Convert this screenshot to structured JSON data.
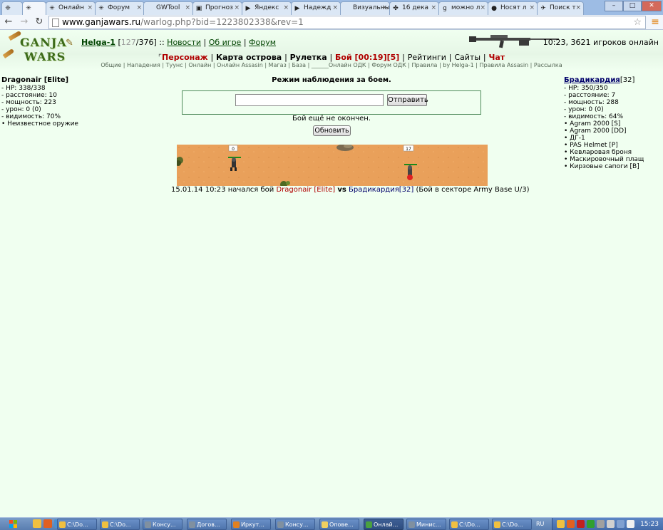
{
  "browser": {
    "tabs": [
      {
        "label": "",
        "icon": "❈"
      },
      {
        "label": "",
        "icon": "✳"
      },
      {
        "label": "Онлайн",
        "icon": "✳"
      },
      {
        "label": "Форум",
        "icon": "✳"
      },
      {
        "label": "GWTool",
        "icon": ""
      },
      {
        "label": "Прогноз",
        "icon": "▣"
      },
      {
        "label": "Яндекс",
        "icon": "▶"
      },
      {
        "label": "Надежд",
        "icon": "▶"
      },
      {
        "label": "Визуальны",
        "icon": ""
      },
      {
        "label": "16 дека",
        "icon": "✤"
      },
      {
        "label": "можно л",
        "icon": "g"
      },
      {
        "label": "Носят л",
        "icon": "●"
      },
      {
        "label": "Поиск т",
        "icon": "✈"
      }
    ],
    "window_buttons": {
      "minimize": "–",
      "maximize": "□",
      "close": "✕"
    },
    "back": "←",
    "forward": "→",
    "reload": "↻",
    "url_host": "www.ganjawars.ru",
    "url_path": "/warlog.php?bid=1223802338&rev=1",
    "bookmark": "☆",
    "menu": "≡"
  },
  "header": {
    "logo_top": "GANJA",
    "logo_bottom": "WARS",
    "username": "Helga-1",
    "hp_current": "127",
    "hp_max": "/376]",
    "hp_open": "[",
    "dots": "::",
    "links": [
      "Новости",
      "Об игре",
      "Форум"
    ],
    "online": "10:23, 3621 игроков онлайн"
  },
  "mainnav": {
    "items": [
      "Персонаж",
      "Карта острова",
      "Рулетка",
      "Бой [00:19][5]",
      "Рейтинги",
      "Сайты",
      "Чат"
    ]
  },
  "subnav": "Общие | Нападения | Туунс | Онлайн | Онлайн Assasin | Магаз | База | ______Онлайн ОДК | Форум ОДК | Правила | by Helga-1 | Правила Assasin | Рассылка",
  "left_player": {
    "name": "Dragonair [Elite]",
    "stats": [
      "- HP: 338/338",
      "- расстояние: 10",
      "- мощность: 223",
      "- урон: 0 (0)",
      "- видимость: 70%"
    ],
    "items": [
      "Неизвестное оружие"
    ]
  },
  "right_player": {
    "name": "Брадикардия",
    "level": "[32]",
    "stats": [
      "- HP: 350/350",
      "- расстояние: 7",
      "- мощность: 288",
      "- урон: 0 (0)",
      "- видимость: 64%"
    ],
    "items": [
      "Agram 2000 [S]",
      "Agram 2000 [DD]",
      "ДГ-1",
      "PAS Helmet [P]",
      "Кевларовая броня",
      "Маскировочный плащ",
      "Кирзовые сапоги [B]"
    ]
  },
  "battle": {
    "title": "Режим наблюдения за боем.",
    "send_label": "Отправить",
    "status": "Бой ещё не окончен.",
    "refresh_label": "Обновить",
    "left_marker": "0",
    "right_marker": "17",
    "log_prefix": "15.01.14 10:23 начался бой",
    "log_red": "Dragonair [Elite]",
    "log_vs": "vs",
    "log_blue": "Брадикардия",
    "log_level": "[32]",
    "log_suffix": "(Бой в секторе Army Base U/3)"
  },
  "taskbar": {
    "windows": [
      {
        "label": "C:\\Do...",
        "color": "#f0c040"
      },
      {
        "label": "C:\\Do...",
        "color": "#f0c040"
      },
      {
        "label": "Консу...",
        "color": "#8090a0"
      },
      {
        "label": "Догов...",
        "color": "#8090a0"
      },
      {
        "label": "Иркут...",
        "color": "#e08020"
      },
      {
        "label": "Консу...",
        "color": "#8090a0"
      },
      {
        "label": "Опове...",
        "color": "#f0d060"
      },
      {
        "label": "Онлай...",
        "color": "#4aa040"
      },
      {
        "label": "Минис...",
        "color": "#8090a0"
      },
      {
        "label": "C:\\Do...",
        "color": "#f0c040"
      },
      {
        "label": "C:\\Do...",
        "color": "#f0c040"
      }
    ],
    "lang": "RU",
    "clock": "15:23"
  },
  "colors": {
    "page_bg": "#f0fff0",
    "red": "#b00000",
    "blue": "#00006a",
    "green_link": "#004400",
    "field": "#e9a05a"
  }
}
